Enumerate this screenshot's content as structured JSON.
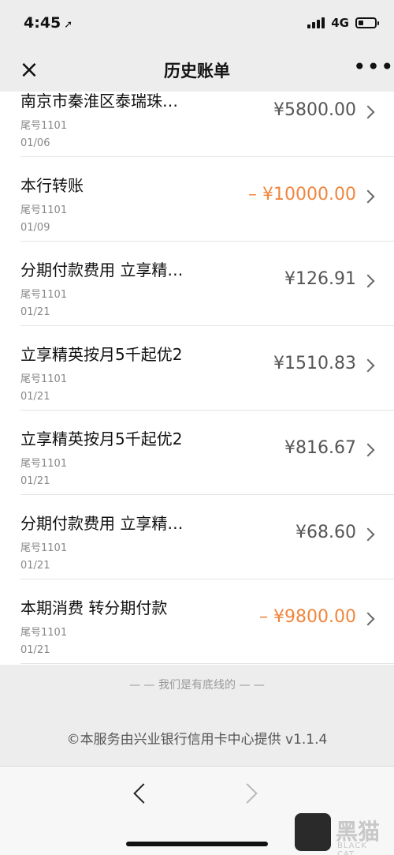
{
  "status_bar": {
    "time": "4:45",
    "location_icon": "location-arrow-icon",
    "network": "4G",
    "battery_level": 0.3
  },
  "nav": {
    "title": "历史账单",
    "close_icon": "×",
    "more_icon": "•••"
  },
  "transactions": [
    {
      "title": "南京市秦淮区泰瑞珠…",
      "card": "尾号1101",
      "date": "01/06",
      "amount": "¥5800.00",
      "negative": false
    },
    {
      "title": "本行转账",
      "card": "尾号1101",
      "date": "01/09",
      "amount": "– ¥10000.00",
      "negative": true
    },
    {
      "title": "分期付款费用 立享精…",
      "card": "尾号1101",
      "date": "01/21",
      "amount": "¥126.91",
      "negative": false
    },
    {
      "title": "立享精英按月5千起优2",
      "card": "尾号1101",
      "date": "01/21",
      "amount": "¥1510.83",
      "negative": false
    },
    {
      "title": "立享精英按月5千起优2",
      "card": "尾号1101",
      "date": "01/21",
      "amount": "¥816.67",
      "negative": false
    },
    {
      "title": "分期付款费用 立享精…",
      "card": "尾号1101",
      "date": "01/21",
      "amount": "¥68.60",
      "negative": false
    },
    {
      "title": "本期消费 转分期付款",
      "card": "尾号1101",
      "date": "01/21",
      "amount": "– ¥9800.00",
      "negative": true
    }
  ],
  "footer": {
    "end_line": "— — 我们是有底线的 — —",
    "copyright": "©本服务由兴业银行信用卡中心提供 v1.1.4"
  },
  "watermark": {
    "text": "黑猫",
    "sub": "BLACK CAT"
  },
  "colors": {
    "negative_amount": "#f0863d",
    "amount": "#555555",
    "background": "#ededed"
  }
}
